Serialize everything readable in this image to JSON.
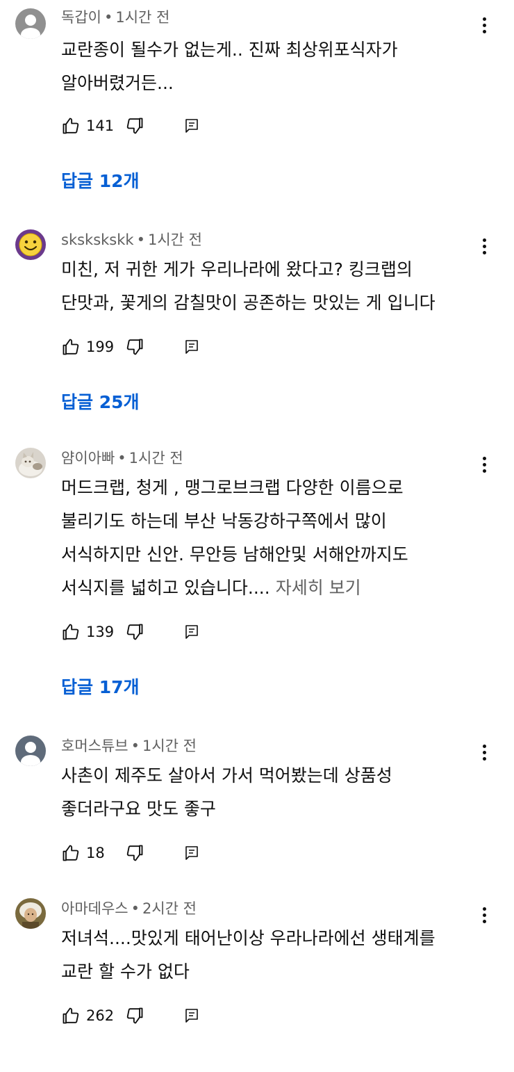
{
  "comments": [
    {
      "author": "독갑이",
      "time": "1시간 전",
      "lines": [
        "교란종이 될수가 없는게.. 진짜 최상위포식자가",
        "알아버렸거든..."
      ],
      "likes": "141",
      "replies": "답글 12개",
      "avatar": "default-user-icon"
    },
    {
      "author": "skskskskk",
      "time": "1시간 전",
      "lines": [
        "미친, 저 귀한 게가 우리나라에 왔다고? 킹크랩의",
        "단맛과, 꽃게의 감칠맛이 공존하는 맛있는 게 입니다"
      ],
      "likes": "199",
      "replies": "답글 25개",
      "avatar": "smiley-face-icon"
    },
    {
      "author": "얌이아빠",
      "time": "1시간 전",
      "lines": [
        "머드크랩, 청게 , 맹그로브크랩 다양한 이름으로",
        "불리기도 하는데 부산 낙동강하구쪽에서 많이",
        "서식하지만 신안. 무안등 남해안및  서해안까지도",
        "서식지를 넓히고 있습니다...."
      ],
      "see_more": "자세히 보기",
      "likes": "139",
      "replies": "답글 17개",
      "avatar": "cat-photo-icon"
    },
    {
      "author": "호머스튜브",
      "time": "1시간 전",
      "lines": [
        "사촌이 제주도 살아서 가서 먹어봤는데 상품성",
        "좋더라구요 맛도 좋구"
      ],
      "likes": "18",
      "avatar": "default-user-icon"
    },
    {
      "author": "아마데우스",
      "time": "2시간 전",
      "lines": [
        "저녀석....맛있게 태어난이상 우라나라에선 생태계를",
        "교란 할 수가 없다"
      ],
      "likes": "262",
      "avatar": "portrait-photo-icon"
    }
  ],
  "ui": {
    "separator": "•",
    "accent_color": "#065fd4",
    "meta_color": "#606060"
  }
}
